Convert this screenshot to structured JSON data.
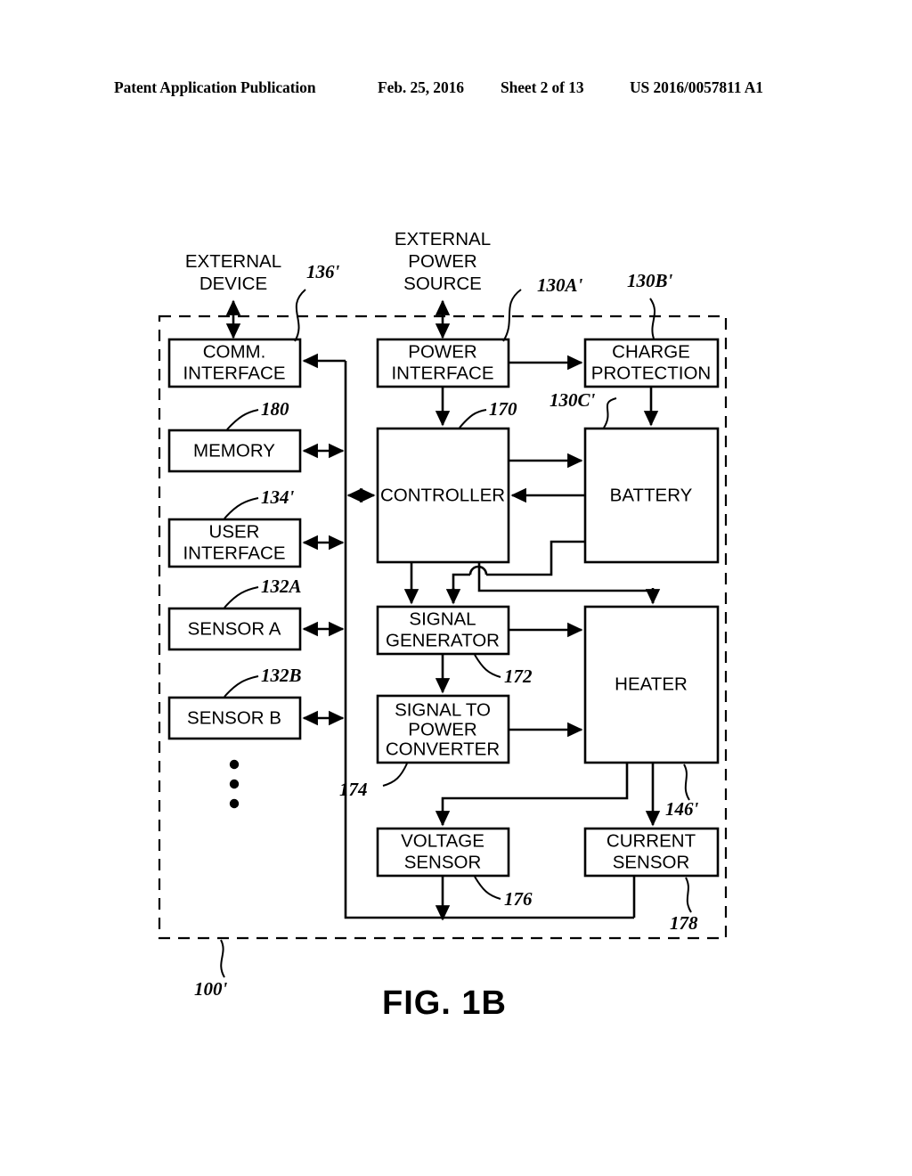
{
  "header": {
    "publication": "Patent Application Publication",
    "date": "Feb. 25, 2016",
    "sheet": "Sheet 2 of 13",
    "patent_number": "US 2016/0057811 A1"
  },
  "figure": {
    "caption": "FIG. 1B",
    "system_ref": "100'"
  },
  "external_labels": [
    {
      "id": "external-device",
      "text_line1": "EXTERNAL",
      "text_line2": "DEVICE",
      "text_line3": ""
    },
    {
      "id": "external-power-source",
      "text_line1": "EXTERNAL",
      "text_line2": "POWER",
      "text_line3": "SOURCE"
    }
  ],
  "blocks": [
    {
      "id": "comm-interface",
      "line1": "COMM.",
      "line2": "INTERFACE",
      "line3": "",
      "ref": "136'"
    },
    {
      "id": "power-interface",
      "line1": "POWER",
      "line2": "INTERFACE",
      "line3": "",
      "ref": "130A'"
    },
    {
      "id": "charge-protection",
      "line1": "CHARGE",
      "line2": "PROTECTION",
      "line3": "",
      "ref": "130B'"
    },
    {
      "id": "memory",
      "line1": "MEMORY",
      "line2": "",
      "line3": "",
      "ref": "180"
    },
    {
      "id": "user-interface",
      "line1": "USER",
      "line2": "INTERFACE",
      "line3": "",
      "ref": "134'"
    },
    {
      "id": "sensor-a",
      "line1": "SENSOR A",
      "line2": "",
      "line3": "",
      "ref": "132A"
    },
    {
      "id": "sensor-b",
      "line1": "SENSOR B",
      "line2": "",
      "line3": "",
      "ref": "132B"
    },
    {
      "id": "controller",
      "line1": "CONTROLLER",
      "line2": "",
      "line3": "",
      "ref": "170"
    },
    {
      "id": "battery",
      "line1": "BATTERY",
      "line2": "",
      "line3": "",
      "ref": "130C'"
    },
    {
      "id": "signal-generator",
      "line1": "SIGNAL",
      "line2": "GENERATOR",
      "line3": "",
      "ref": "172"
    },
    {
      "id": "signal-to-power-converter",
      "line1": "SIGNAL TO",
      "line2": "POWER",
      "line3": "CONVERTER",
      "ref": "174"
    },
    {
      "id": "heater",
      "line1": "HEATER",
      "line2": "",
      "line3": "",
      "ref": "146'"
    },
    {
      "id": "voltage-sensor",
      "line1": "VOLTAGE",
      "line2": "SENSOR",
      "line3": "",
      "ref": "176"
    },
    {
      "id": "current-sensor",
      "line1": "CURRENT",
      "line2": "SENSOR",
      "line3": "",
      "ref": "178"
    }
  ],
  "text": {
    "comm_l1": "COMM.",
    "comm_l2": "INTERFACE",
    "power_l1": "POWER",
    "power_l2": "INTERFACE",
    "charge_l1": "CHARGE",
    "charge_l2": "PROTECTION",
    "memory": "MEMORY",
    "ui_l1": "USER",
    "ui_l2": "INTERFACE",
    "sensor_a": "SENSOR A",
    "sensor_b": "SENSOR B",
    "controller": "CONTROLLER",
    "battery": "BATTERY",
    "siggen_l1": "SIGNAL",
    "siggen_l2": "GENERATOR",
    "s2p_l1": "SIGNAL TO",
    "s2p_l2": "POWER",
    "s2p_l3": "CONVERTER",
    "heater": "HEATER",
    "vsens_l1": "VOLTAGE",
    "vsens_l2": "SENSOR",
    "isens_l1": "CURRENT",
    "isens_l2": "SENSOR",
    "ext_dev_l1": "EXTERNAL",
    "ext_dev_l2": "DEVICE",
    "ext_pwr_l1": "EXTERNAL",
    "ext_pwr_l2": "POWER",
    "ext_pwr_l3": "SOURCE"
  },
  "refs": {
    "r136": "136'",
    "r130A": "130A'",
    "r130B": "130B'",
    "r130C": "130C'",
    "r180": "180",
    "r134": "134'",
    "r132A": "132A",
    "r132B": "132B",
    "r170": "170",
    "r172": "172",
    "r174": "174",
    "r176": "176",
    "r146": "146'",
    "r178": "178",
    "r100": "100'"
  },
  "colors": {
    "ink": "#000000",
    "paper": "#ffffff"
  }
}
